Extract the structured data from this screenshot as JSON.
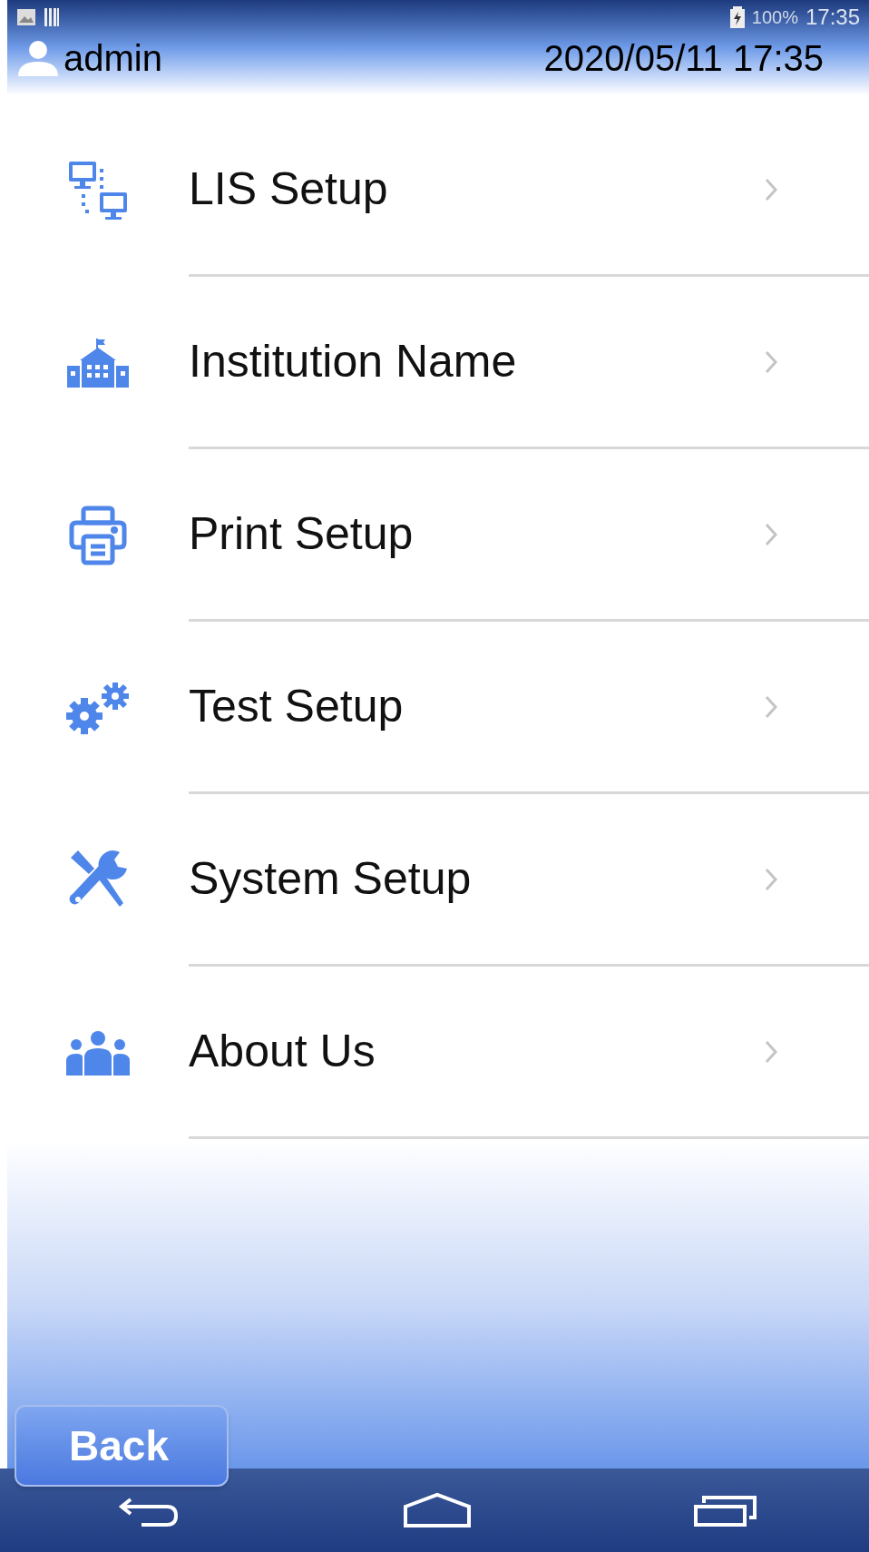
{
  "status_bar": {
    "battery": "100%",
    "time": "17:35"
  },
  "header": {
    "user": "admin",
    "datetime": "2020/05/11 17:35"
  },
  "menu": [
    {
      "label": "LIS Setup"
    },
    {
      "label": "Institution Name"
    },
    {
      "label": "Print Setup"
    },
    {
      "label": "Test Setup"
    },
    {
      "label": "System Setup"
    },
    {
      "label": "About Us"
    }
  ],
  "back_button": "Back"
}
